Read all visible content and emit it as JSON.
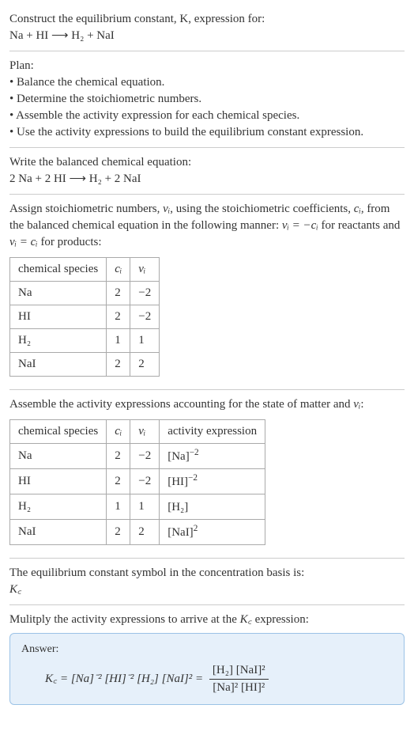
{
  "header": {
    "title_line1": "Construct the equilibrium constant, K, expression for:",
    "reaction_unbalanced": "Na + HI  ⟶  H₂ + NaI"
  },
  "plan": {
    "heading": "Plan:",
    "items": [
      "• Balance the chemical equation.",
      "• Determine the stoichiometric numbers.",
      "• Assemble the activity expression for each chemical species.",
      "• Use the activity expressions to build the equilibrium constant expression."
    ]
  },
  "balanced": {
    "heading": "Write the balanced chemical equation:",
    "equation": "2 Na + 2 HI  ⟶  H₂ + 2 NaI"
  },
  "stoich": {
    "text_part1": "Assign stoichiometric numbers, ",
    "nu": "νᵢ",
    "text_part2": ", using the stoichiometric coefficients, ",
    "ci": "cᵢ",
    "text_part3": ", from the balanced chemical equation in the following manner: ",
    "rule_reactants": "νᵢ = −cᵢ",
    "text_part4": " for reactants and ",
    "rule_products": "νᵢ = cᵢ",
    "text_part5": " for products:",
    "table1": {
      "headers": [
        "chemical species",
        "cᵢ",
        "νᵢ"
      ],
      "rows": [
        [
          "Na",
          "2",
          "−2"
        ],
        [
          "HI",
          "2",
          "−2"
        ],
        [
          "H₂",
          "1",
          "1"
        ],
        [
          "NaI",
          "2",
          "2"
        ]
      ]
    }
  },
  "activity": {
    "heading_part1": "Assemble the activity expressions accounting for the state of matter and ",
    "heading_nu": "νᵢ",
    "heading_part2": ":",
    "table2": {
      "headers": [
        "chemical species",
        "cᵢ",
        "νᵢ",
        "activity expression"
      ],
      "rows": [
        {
          "species": "Na",
          "c": "2",
          "nu": "−2",
          "expr_base": "[Na]",
          "expr_sup": "−2"
        },
        {
          "species": "HI",
          "c": "2",
          "nu": "−2",
          "expr_base": "[HI]",
          "expr_sup": "−2"
        },
        {
          "species": "H₂",
          "c": "1",
          "nu": "1",
          "expr_base": "[H₂]",
          "expr_sup": ""
        },
        {
          "species": "NaI",
          "c": "2",
          "nu": "2",
          "expr_base": "[NaI]",
          "expr_sup": "2"
        }
      ]
    }
  },
  "kc_symbol": {
    "line1": "The equilibrium constant symbol in the concentration basis is:",
    "symbol": "K꜀"
  },
  "multiply": {
    "heading_part1": "Mulitply the activity expressions to arrive at the ",
    "kc": "K꜀",
    "heading_part2": " expression:"
  },
  "answer": {
    "label": "Answer:",
    "lhs": "K꜀ = [Na]⁻² [HI]⁻² [H₂] [NaI]² = ",
    "frac_num": "[H₂] [NaI]²",
    "frac_den": "[Na]² [HI]²"
  },
  "chart_data": {
    "type": "table",
    "tables": [
      {
        "title": "Stoichiometric numbers",
        "columns": [
          "chemical species",
          "c_i",
          "nu_i"
        ],
        "rows": [
          [
            "Na",
            2,
            -2
          ],
          [
            "HI",
            2,
            -2
          ],
          [
            "H2",
            1,
            1
          ],
          [
            "NaI",
            2,
            2
          ]
        ]
      },
      {
        "title": "Activity expressions",
        "columns": [
          "chemical species",
          "c_i",
          "nu_i",
          "activity expression"
        ],
        "rows": [
          [
            "Na",
            2,
            -2,
            "[Na]^-2"
          ],
          [
            "HI",
            2,
            -2,
            "[HI]^-2"
          ],
          [
            "H2",
            1,
            1,
            "[H2]"
          ],
          [
            "NaI",
            2,
            2,
            "[NaI]^2"
          ]
        ]
      }
    ]
  }
}
